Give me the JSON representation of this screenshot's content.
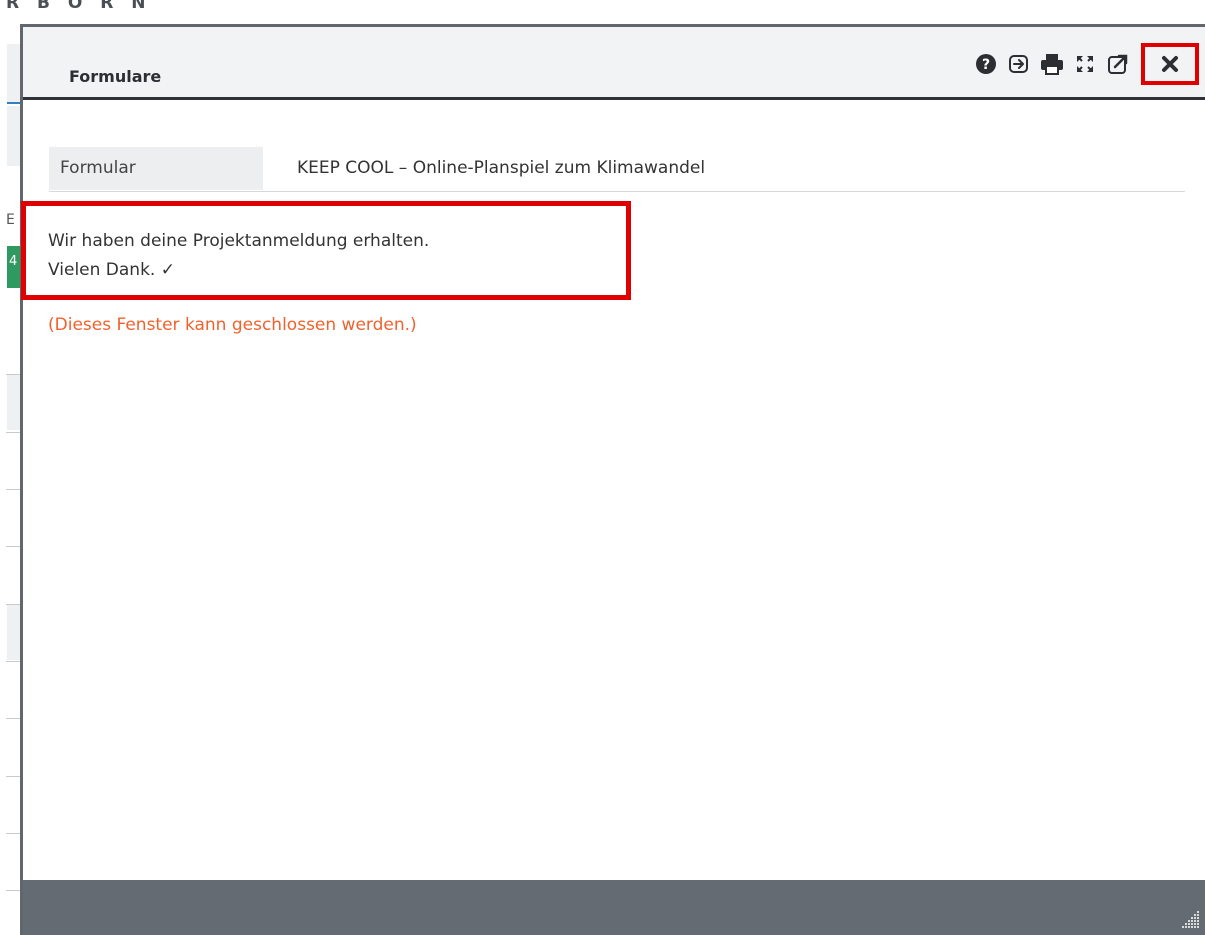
{
  "background": {
    "brand_text": "R B O R N",
    "side_letter": "E",
    "green_tile_text": "4"
  },
  "dialog": {
    "title": "Formulare",
    "toolbar": [
      {
        "name": "help-icon"
      },
      {
        "name": "export-icon"
      },
      {
        "name": "print-icon"
      },
      {
        "name": "fullscreen-icon"
      },
      {
        "name": "popout-icon"
      },
      {
        "name": "close-icon"
      }
    ],
    "form": {
      "label": "Formular",
      "value": "KEEP COOL – Online-Planspiel zum Klimawandel"
    },
    "confirmation": {
      "line1": "Wir haben deine Projektanmeldung erhalten.",
      "line2": "Vielen Dank. ✓"
    },
    "close_hint": "(Dieses Fenster kann geschlossen werden.)"
  },
  "colors": {
    "header_bg": "#f2f3f4",
    "footer_bg": "#646b73",
    "highlight": "#e10000",
    "hint": "#f0622d"
  }
}
